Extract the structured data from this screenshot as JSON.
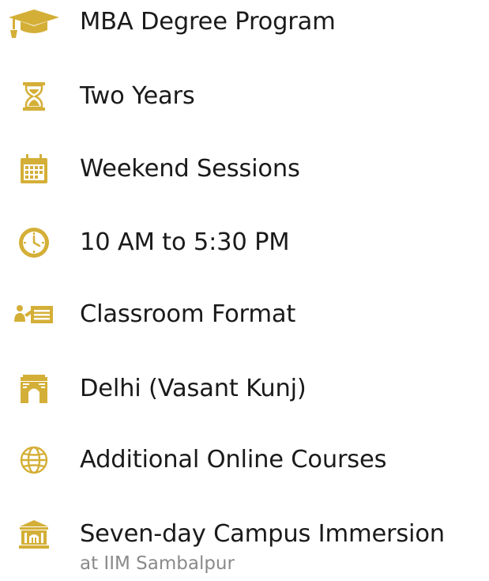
{
  "colors": {
    "icon_gold": "#D4AF37",
    "text_primary": "#1a1a1a",
    "text_secondary": "#8a8a8a"
  },
  "items": [
    {
      "icon": "graduation-cap-icon",
      "label": "MBA Degree Program"
    },
    {
      "icon": "hourglass-icon",
      "label": "Two Years"
    },
    {
      "icon": "calendar-icon",
      "label": "Weekend Sessions"
    },
    {
      "icon": "clock-icon",
      "label": "10 AM to 5:30 PM"
    },
    {
      "icon": "classroom-icon",
      "label": "Classroom Format"
    },
    {
      "icon": "india-gate-icon",
      "label": "Delhi (Vasant Kunj)"
    },
    {
      "icon": "globe-icon",
      "label": "Additional Online Courses"
    },
    {
      "icon": "institution-icon",
      "label": "Seven-day Campus Immersion",
      "sublabel": "at IIM Sambalpur"
    }
  ]
}
